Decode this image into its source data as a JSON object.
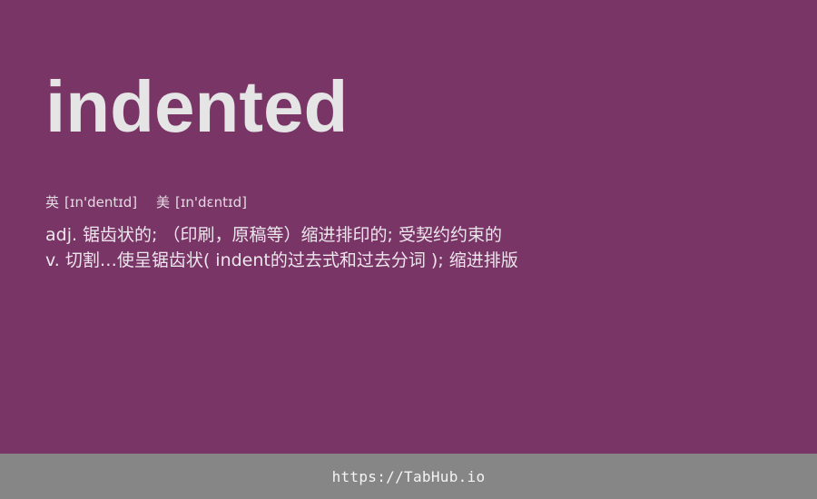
{
  "word": "indented",
  "pronunciations": [
    {
      "label": "英",
      "ipa": "[ɪn'dentɪd]"
    },
    {
      "label": "美",
      "ipa": "[ɪn'dɛntɪd]"
    }
  ],
  "definitions": [
    "adj. 锯齿状的; （印刷，原稿等）缩进排印的; 受契约约束的",
    "v. 切割…使呈锯齿状( indent的过去式和过去分词 ); 缩进排版"
  ],
  "footer": {
    "url": "https://TabHub.io"
  },
  "colors": {
    "background": "#7a3567",
    "footer_background": "#868686",
    "text": "#ececec"
  }
}
